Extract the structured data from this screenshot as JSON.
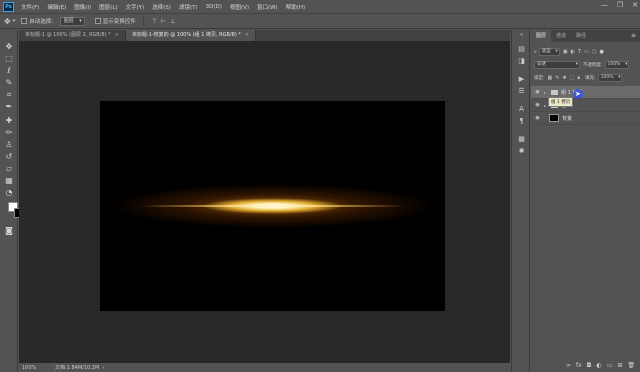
{
  "app": {
    "logo": "Ps",
    "menu": [
      "文件(F)",
      "编辑(E)",
      "图像(I)",
      "图层(L)",
      "文字(Y)",
      "选择(S)",
      "滤镜(T)",
      "3D(D)",
      "视图(V)",
      "窗口(W)",
      "帮助(H)"
    ],
    "window_controls": [
      "—",
      "❐",
      "✕"
    ]
  },
  "options_bar": {
    "auto_select_label": "自动选择：",
    "auto_select_value": "图层",
    "show_transform_label": "显示变换控件"
  },
  "doc_tabs": [
    {
      "label": "未标题-1 @ 100% (图层 2, RGB/8) *",
      "active": false
    },
    {
      "label": "未标题-1-恢复的 @ 100% (组 1 拷贝, RGB/8) *",
      "active": true
    }
  ],
  "status": {
    "zoom": "100%",
    "doc_info": "文档:1.84M/10.2M"
  },
  "panel": {
    "tabs": [
      "图层",
      "通道",
      "路径"
    ],
    "menu_icon": "≡",
    "kind_filter": "类型",
    "blend_mode": "穿透",
    "opacity_label": "不透明度:",
    "opacity_value": "100%",
    "lock_label": "锁定:",
    "fill_label": "填充:",
    "fill_value": "100%",
    "tooltip": "组 1 拷贝"
  },
  "layers": [
    {
      "name": "组 1 拷贝",
      "type": "group",
      "selected": true,
      "visible": true
    },
    {
      "name": "组 1",
      "type": "group",
      "selected": false,
      "visible": true
    },
    {
      "name": "背景",
      "type": "background",
      "selected": false,
      "visible": true
    }
  ],
  "colors": {
    "ui_bg": "#535353",
    "canvas_bg": "#282828",
    "glow": "#ffb020",
    "foreground": "#ffffff",
    "background": "#000000"
  },
  "icons": {
    "toolbar": [
      "move-icon",
      "marquee-icon",
      "lasso-icon",
      "quick-select-icon",
      "crop-icon",
      "eyedropper-icon",
      "healing-icon",
      "brush-icon",
      "stamp-icon",
      "history-brush-icon",
      "eraser-icon",
      "gradient-icon",
      "blur-icon",
      "dodge-icon",
      "pen-icon",
      "type-icon",
      "path-select-icon",
      "rectangle-icon",
      "hand-icon",
      "zoom-icon"
    ]
  }
}
